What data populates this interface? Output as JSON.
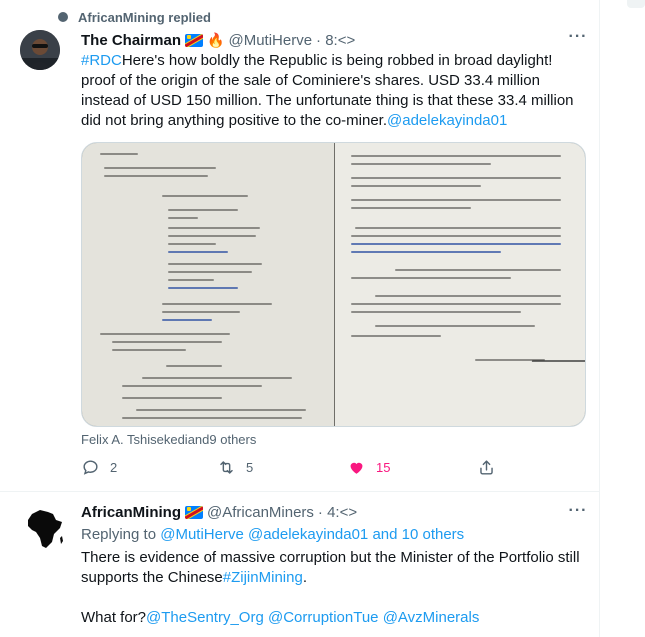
{
  "retweet": {
    "text": "AfricanMining replied"
  },
  "tweet1": {
    "name": "The Chairman",
    "handle": "@MutiHerve",
    "time": "· 8:<>",
    "text_hashtag": "#RDC",
    "text": "Here's how boldly the Republic is being robbed in broad daylight! proof of the origin of the sale of Cominiere's shares. USD 33.4 million instead of USD 150 million. The unfortunate thing is that these 33.4 million did not bring anything positive to the co-miner.",
    "text_mention": "@adelekayinda01",
    "caption": "Felix A. Tshisekediand9 others",
    "replies": "2",
    "retweets": "5",
    "likes": "15",
    "more_icon": "more-horizontal-icon",
    "colors": {
      "like": "#f91880",
      "link": "#1d9bf0",
      "muted": "#536471"
    }
  },
  "tweet2": {
    "name": "AfricanMining",
    "handle": "@AfricanMiners",
    "time": "· 4:<>",
    "replying_label": "Replying to ",
    "replying_mentions": "@MutiHerve @adelekayinda01 and 10 others",
    "text_line": "There is evidence of massive corruption but the Minister of the Portfolio still supports the Chinese",
    "text_hashtag": "#ZijinMining",
    "text_end": ".",
    "q_label": "What for?",
    "q_mentions": "@TheSentry_Org @CorruptionTue @AvzMinerals",
    "more_icon": "more-horizontal-icon"
  }
}
